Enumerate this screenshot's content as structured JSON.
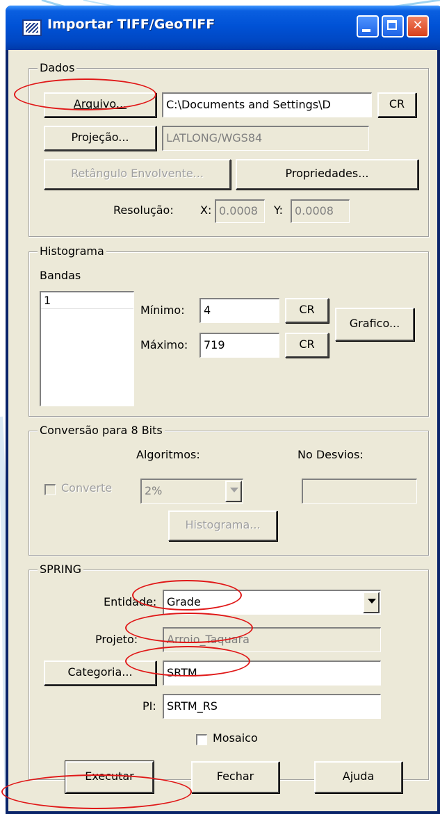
{
  "window": {
    "title": "Importar TIFF/GeoTIFF",
    "title_color": "#0052d6"
  },
  "dados": {
    "legend": "Dados",
    "arquivo_label": "Arquivo...",
    "arquivo_value": "C:\\Documents and Settings\\D",
    "cr_label": "CR",
    "projecao_label": "Projeção...",
    "projecao_value": "LATLONG/WGS84",
    "retangulo_label": "Retângulo Envolvente...",
    "propriedades_label": "Propriedades...",
    "resolucao_label": "Resolução:",
    "x_label": "X:",
    "x_value": "0.0008",
    "y_label": "Y:",
    "y_value": "0.0008"
  },
  "histograma": {
    "legend": "Histograma",
    "bandas_label": "Bandas",
    "bandas_items": [
      "1"
    ],
    "minimo_label": "Mínimo:",
    "minimo_value": "4",
    "maximo_label": "Máximo:",
    "maximo_value": "719",
    "cr_label": "CR",
    "grafico_label": "Grafico..."
  },
  "conversao": {
    "legend": "Conversão para 8 Bits",
    "algoritmos_label": "Algoritmos:",
    "no_desvios_label": "No Desvios:",
    "converte_label": "Converte",
    "algoritmo_value": "2%",
    "no_desvios_value": "",
    "histograma_button": "Histograma..."
  },
  "spring": {
    "legend": "SPRING",
    "entidade_label": "Entidade:",
    "entidade_value": "Grade",
    "projeto_label": "Projeto:",
    "projeto_value": "Arroio_Taquara",
    "categoria_label": "Categoria...",
    "categoria_value": "SRTM",
    "pi_label": "PI:",
    "pi_value": "SRTM_RS",
    "mosaico_label": "Mosaico"
  },
  "footer": {
    "executar": "Executar",
    "fechar": "Fechar",
    "ajuda": "Ajuda"
  },
  "annotation_color": "#e01818"
}
